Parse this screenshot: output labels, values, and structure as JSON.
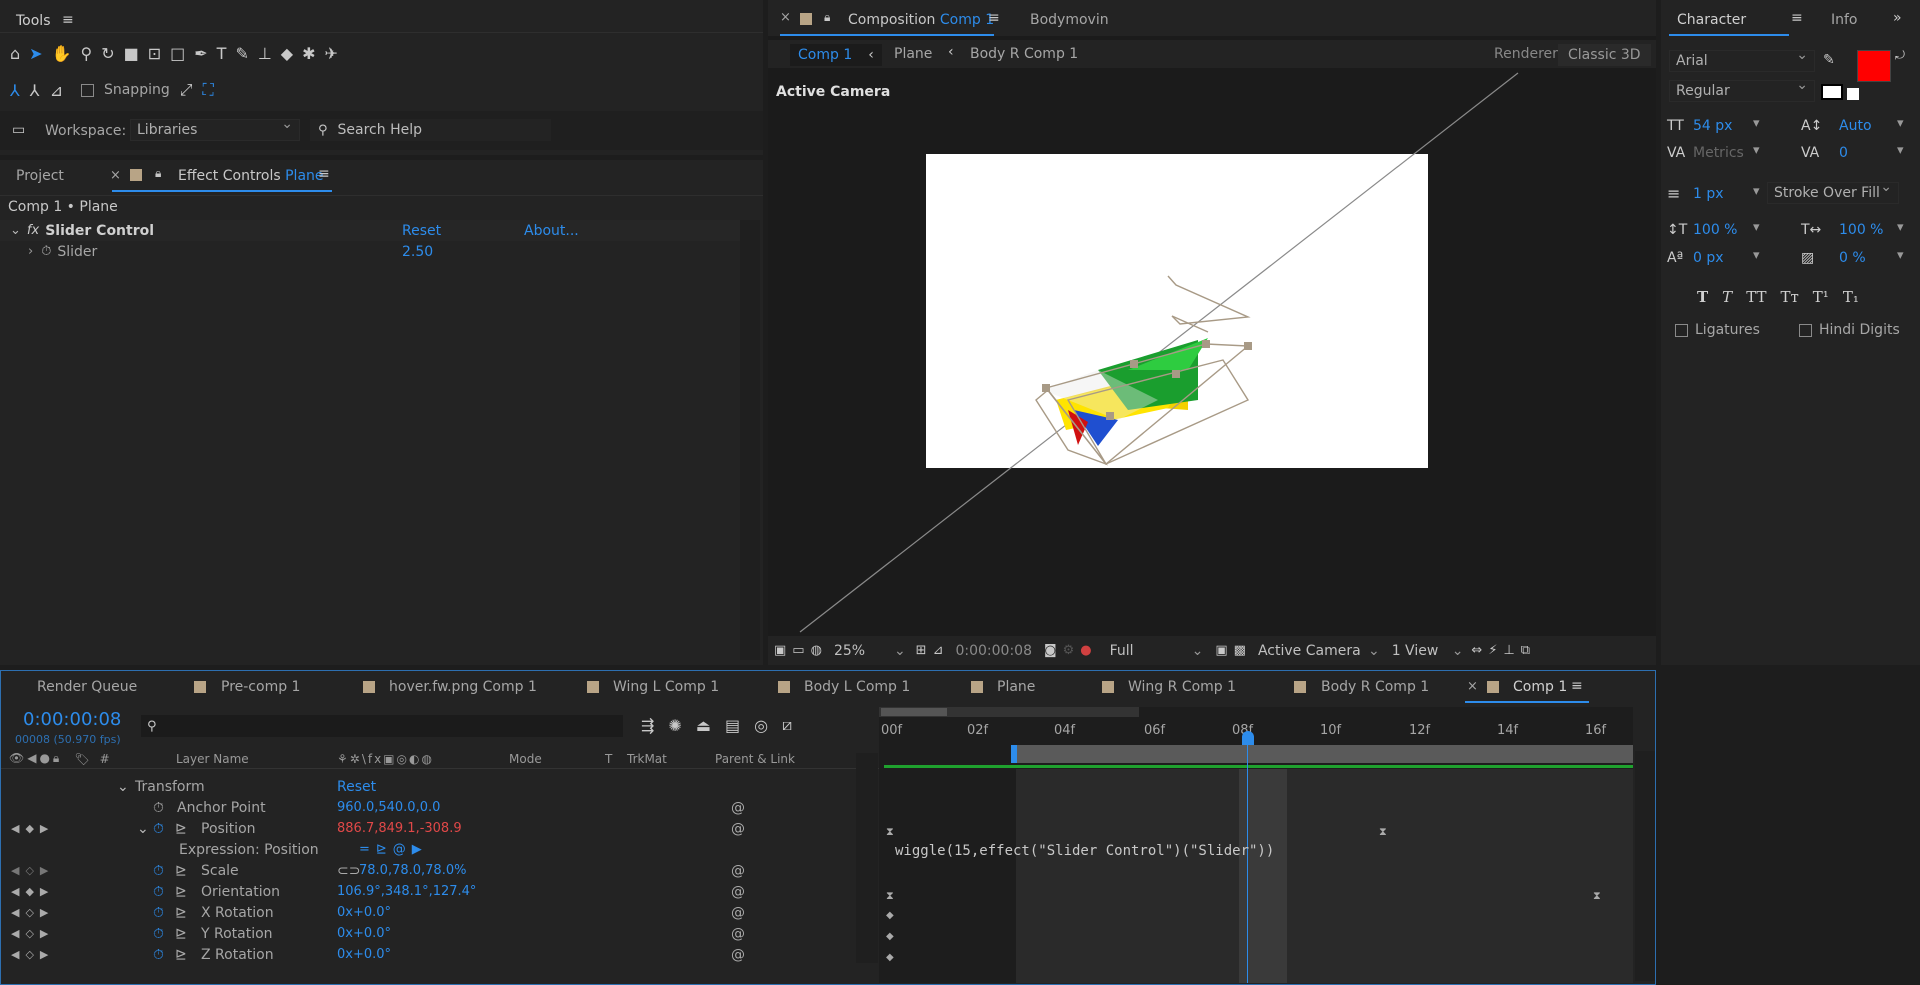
{
  "tools": {
    "title": "Tools",
    "snapping": "Snapping",
    "workspace_label": "Workspace:",
    "workspace_value": "Libraries",
    "search_placeholder": "Search Help"
  },
  "project": {
    "tab_project": "Project",
    "tab_effect": "Effect Controls",
    "tab_effect_layer": "Plane",
    "breadcrumb": "Comp 1 • Plane",
    "effect_name": "Slider Control",
    "reset": "Reset",
    "about": "About...",
    "slider_label": "Slider",
    "slider_value": "2.50"
  },
  "comp": {
    "tab_prefix": "Composition",
    "tab_name": "Comp 1",
    "tab_bodymovin": "Bodymovin",
    "crumbs": [
      "Comp 1",
      "Plane",
      "Body R Comp 1"
    ],
    "renderer_label": "Renderer:",
    "renderer_value": "Classic 3D",
    "active_camera": "Active Camera",
    "zoom": "25%",
    "timecode": "0:00:00:08",
    "resolution": "Full",
    "camera": "Active Camera",
    "views": "1 View"
  },
  "character": {
    "tab": "Character",
    "tab_info": "Info",
    "font": "Arial",
    "style": "Regular",
    "size": "54 px",
    "leading": "Auto",
    "kerning": "Metrics",
    "tracking": "0",
    "stroke_width": "1 px",
    "stroke_mode": "Stroke Over Fill",
    "vscale": "100 %",
    "hscale": "100 %",
    "baseline": "0 px",
    "tsume": "0 %",
    "ligatures": "Ligatures",
    "hindi": "Hindi Digits",
    "fill_color": "#ff0000",
    "style_buttons": [
      "T",
      "T",
      "TT",
      "Tт",
      "T¹",
      "T₁"
    ]
  },
  "timeline": {
    "tabs": [
      "Render Queue",
      "Pre-comp 1",
      "hover.fw.png Comp 1",
      "Wing L Comp 1",
      "Body L Comp 1",
      "Plane",
      "Wing R Comp 1",
      "Body R Comp 1",
      "Comp 1"
    ],
    "timecode": "0:00:00:08",
    "fps": "00008 (50.970 fps)",
    "columns": {
      "num": "#",
      "layer": "Layer Name",
      "mode": "Mode",
      "t": "T",
      "trkmat": "TrkMat",
      "parent": "Parent & Link"
    },
    "ruler": [
      "00f",
      "02f",
      "04f",
      "06f",
      "08f",
      "10f",
      "12f",
      "14f",
      "16f"
    ],
    "transform": "Transform",
    "reset": "Reset",
    "props": [
      {
        "name": "Anchor Point",
        "value": "960.0,540.0,0.0"
      },
      {
        "name": "Position",
        "value": "886.7,849.1,-308.9"
      },
      {
        "name": "Expression: Position",
        "value": ""
      },
      {
        "name": "Scale",
        "value": "78.0,78.0,78.0%"
      },
      {
        "name": "Orientation",
        "value": "106.9°,348.1°,127.4°"
      },
      {
        "name": "X Rotation",
        "value": "0x+0.0°"
      },
      {
        "name": "Y Rotation",
        "value": "0x+0.0°"
      },
      {
        "name": "Z Rotation",
        "value": "0x+0.0°"
      }
    ],
    "expression": "wiggle(15,effect(\"Slider Control\")(\"Slider\"))"
  }
}
